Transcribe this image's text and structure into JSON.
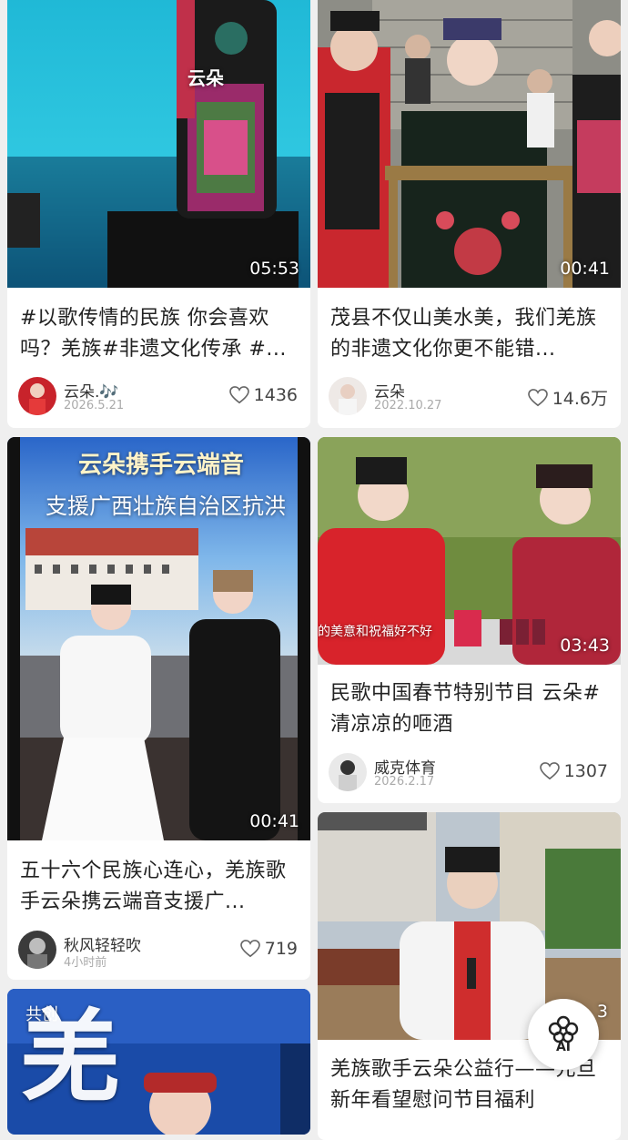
{
  "cards": [
    {
      "title": "#以歌传情的民族 你会喜欢吗？羌族#非遗文化传承 #...",
      "duration": "05:53",
      "overlay": "云朵",
      "author": "云朵.🎶",
      "time": "2026.5.21",
      "likes": "1436"
    },
    {
      "title": "茂县不仅山美水美，我们羌族的非遗文化你更不能错...",
      "duration": "00:41",
      "author": "云朵",
      "time": "2022.10.27",
      "likes": "14.6万"
    },
    {
      "title": "五十六个民族心连心，羌族歌手云朵携云端音支援广...",
      "duration": "00:41",
      "overlay_line1": "云朵携手云端音",
      "overlay_line2": "支援广西壮族自治区抗洪",
      "author": "秋风轻轻吹",
      "time": "4小时前",
      "likes": "719"
    },
    {
      "title": "民歌中国春节特别节目  云朵#清凉凉的咂酒",
      "duration": "03:43",
      "caption": "的美意和祝福好不好",
      "author": "威克体育",
      "time": "2026.2.17",
      "likes": "1307"
    },
    {
      "badge": "共创",
      "big_char": "羌"
    },
    {
      "title": "羌族歌手云朵公益行——元旦新年看望慰问节目福利",
      "duration": "3"
    }
  ],
  "ai_button": {
    "label": "AI"
  },
  "colors": {
    "background": "#efefef",
    "card": "#ffffff",
    "text": "#222222",
    "muted": "#aaaaaa"
  }
}
